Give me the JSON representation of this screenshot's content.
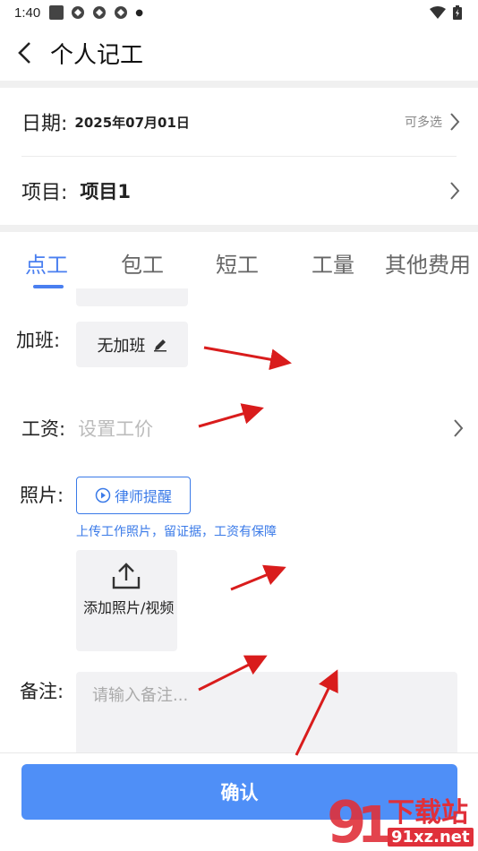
{
  "status_bar": {
    "time": "1:40"
  },
  "header": {
    "title": "个人记工"
  },
  "date_row": {
    "label": "日期:",
    "value": "2025年07月01日",
    "hint": "可多选"
  },
  "project_row": {
    "label": "项目:",
    "value": "项目1"
  },
  "tabs": [
    {
      "label": "点工",
      "active": true
    },
    {
      "label": "包工",
      "active": false
    },
    {
      "label": "短工",
      "active": false
    },
    {
      "label": "工量",
      "active": false
    },
    {
      "label": "其他费用",
      "active": false
    }
  ],
  "overtime": {
    "label": "加班:",
    "value": "无加班"
  },
  "wage": {
    "label": "工资:",
    "placeholder": "设置工价"
  },
  "photo": {
    "label": "照片:",
    "lawyer_button": "律师提醒",
    "hint": "上传工作照片，留证据，工资有保障",
    "upload_label": "添加照片/视频"
  },
  "remark": {
    "label": "备注:",
    "placeholder": "请输入备注..."
  },
  "confirm_label": "确认",
  "watermark": {
    "brand": "下载站",
    "domain": "91xz.net"
  },
  "colors": {
    "accent": "#4a7ff0",
    "button": "#4f8ff7",
    "link": "#3a7ae8",
    "annotation_arrow": "#d91c1c"
  }
}
